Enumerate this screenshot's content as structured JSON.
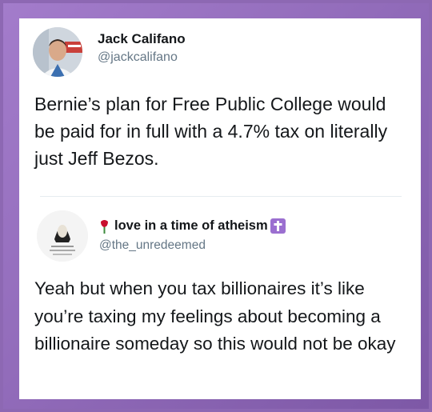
{
  "tweet": {
    "author_name": "Jack Califano",
    "author_handle": "@jackcalifano",
    "text": "Bernie’s plan for Free Public College would be paid for in full with a 4.7% tax on literally just Jeff Bezos."
  },
  "reply": {
    "author_name": "love in a time of atheism",
    "author_handle": "@the_unredeemed",
    "text": "Yeah but when you tax billionaires it’s like you’re taxing my feelings about becoming a billionaire someday so this would not be okay"
  },
  "colors": {
    "frame": "#8d68b3",
    "text": "#14171a",
    "secondary": "#657786",
    "cross_bg": "#9b6fd0"
  },
  "icons": {
    "rose": "rose-emoji-icon",
    "cross": "latin-cross-emoji-icon"
  }
}
